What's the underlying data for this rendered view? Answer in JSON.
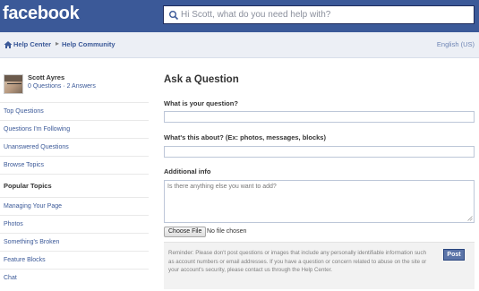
{
  "header": {
    "logo": "facebook",
    "search_placeholder": "Hi Scott, what do you need help with?"
  },
  "breadcrumb": {
    "items": [
      "Help Center",
      "Help Community"
    ],
    "separator": "▸",
    "language": "English (US)"
  },
  "profile": {
    "name": "Scott Ayres",
    "stats": "0 Questions · 2 Answers"
  },
  "sidebar": {
    "links": [
      "Top Questions",
      "Questions I'm Following",
      "Unanswered Questions",
      "Browse Topics"
    ],
    "popular_heading": "Popular Topics",
    "popular": [
      "Managing Your Page",
      "Photos",
      "Something's Broken",
      "Feature Blocks",
      "Chat"
    ]
  },
  "form": {
    "title": "Ask a Question",
    "question_label": "What is your question?",
    "question_value": "",
    "about_label": "What's this about? (Ex: photos, messages, blocks)",
    "about_value": "",
    "info_label": "Additional info",
    "info_placeholder": "Is there anything else you want to add?",
    "choose_file": "Choose File",
    "no_file": "No file chosen",
    "reminder": "Reminder: Please don't post questions or images that include any personally identifiable information such as account numbers or email addresses. If you have a question or concern related to abuse on the site or your account's security, please contact us through the Help Center.",
    "post_button": "Post"
  },
  "colors": {
    "brand_blue": "#3b5998",
    "crumb_bg": "#eceff5",
    "link": "#3b5998"
  },
  "icons": [
    "search-icon",
    "home-icon",
    "resize-grip-icon"
  ]
}
